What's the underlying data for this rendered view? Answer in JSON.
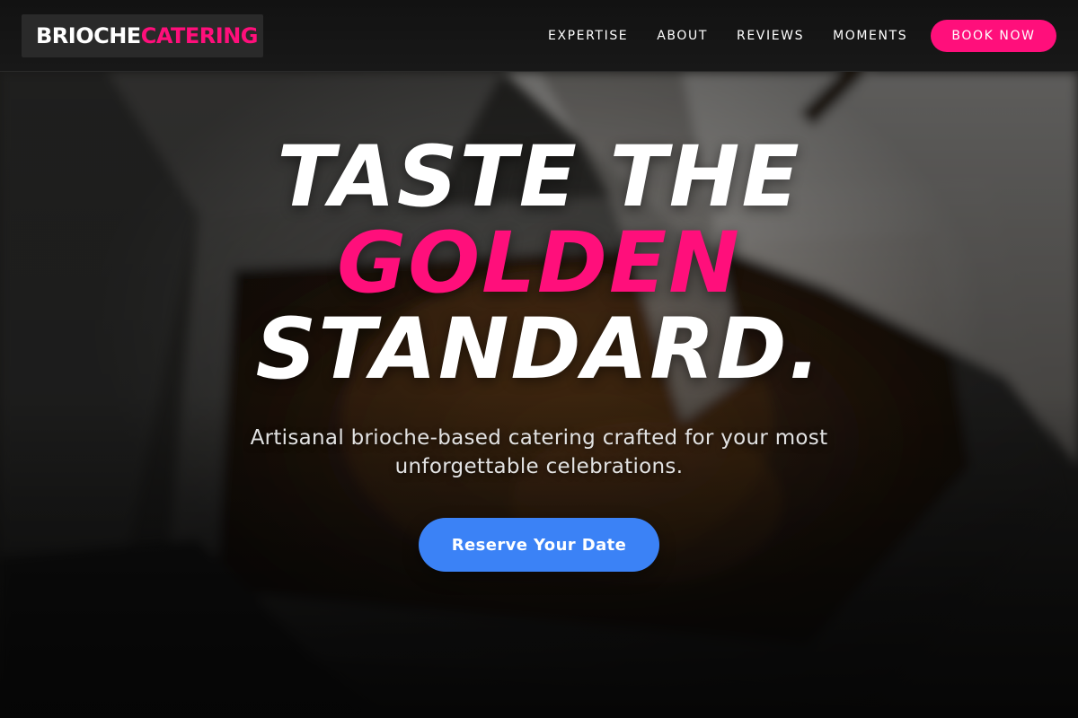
{
  "brand": {
    "part1": "BRIOCHE",
    "part2": "CATERING"
  },
  "nav": {
    "items": [
      {
        "label": "EXPERTISE"
      },
      {
        "label": "ABOUT"
      },
      {
        "label": "REVIEWS"
      },
      {
        "label": "MOMENTS"
      }
    ],
    "cta_label": "BOOK NOW"
  },
  "hero": {
    "headline_line1": "TASTE THE",
    "headline_line2": "GOLDEN",
    "headline_line3": "STANDARD.",
    "subtitle": "Artisanal brioche-based catering crafted for your most unforgettable celebrations.",
    "cta_label": "Reserve Your Date"
  },
  "colors": {
    "accent_pink": "#ff0f7b",
    "cta_blue": "#3b82f6",
    "header_bg": "#151515"
  }
}
